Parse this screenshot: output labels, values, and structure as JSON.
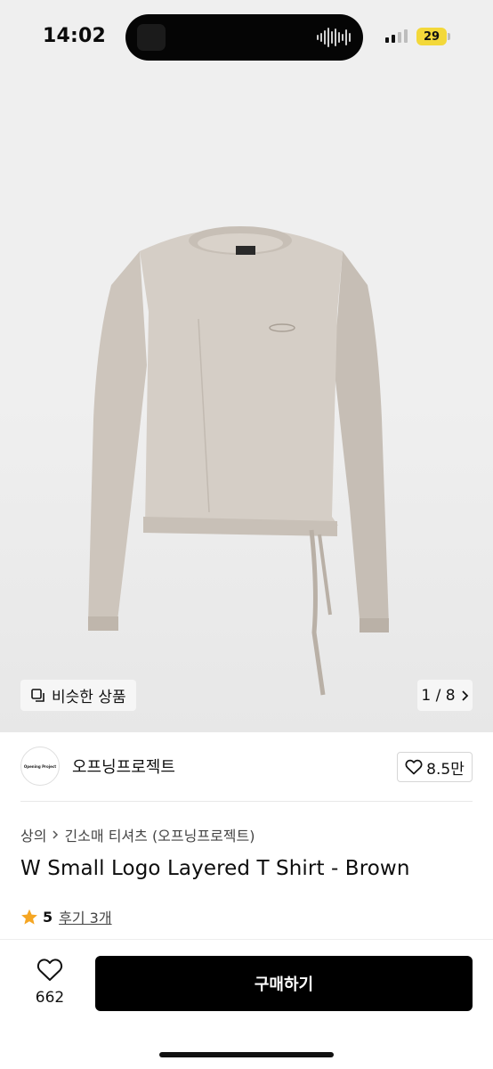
{
  "status_bar": {
    "time": "14:02",
    "battery": "29",
    "battery_color": "#f3d83a"
  },
  "hero": {
    "similar_label": "비슷한 상품",
    "page_indicator": "1 / 8",
    "icons": [
      "copy-icon",
      "chevron-right-icon"
    ]
  },
  "brand": {
    "name": "오프닝프로젝트",
    "logo_text": "Opening Project",
    "likes": "8.5만"
  },
  "product": {
    "breadcrumb_category": "상의",
    "breadcrumb_sub": "긴소매 티셔츠 (오프닝프로젝트)",
    "title": "W Small Logo Layered T Shirt - Brown",
    "rating": "5",
    "review_label": "후기 3개",
    "star_color": "#f5a623"
  },
  "bottom_bar": {
    "like_count": "662",
    "buy_label": "구매하기",
    "buy_color": "#000000"
  }
}
